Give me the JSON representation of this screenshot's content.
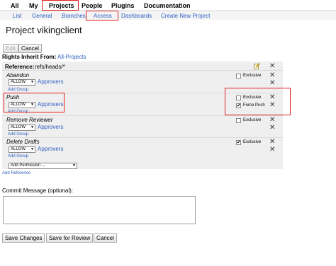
{
  "topnav": {
    "items": [
      {
        "label": "All"
      },
      {
        "label": "My"
      },
      {
        "label": "Projects"
      },
      {
        "label": "People"
      },
      {
        "label": "Plugins"
      },
      {
        "label": "Documentation"
      }
    ]
  },
  "subnav": {
    "items": [
      {
        "label": "List"
      },
      {
        "label": "General"
      },
      {
        "label": "Branches"
      },
      {
        "label": "Access"
      },
      {
        "label": "Dashboards"
      },
      {
        "label": "Create New Project"
      }
    ]
  },
  "page": {
    "title": "Project vikingclient",
    "edit_label": "Edit",
    "cancel_label": "Cancel",
    "rights_inherit_label": "Rights Inherit From:",
    "rights_inherit_link": "All-Projects"
  },
  "reference": {
    "label": "Reference:",
    "value": "refs/heads/*"
  },
  "permissions": [
    {
      "name": "Abandon",
      "rule_action": "ALLOW",
      "group": "Approvers",
      "add_group": "Add Group",
      "options": [
        {
          "label": "Exclusive",
          "checked": false
        }
      ]
    },
    {
      "name": "Push",
      "rule_action": "ALLOW",
      "group": "Approvers",
      "add_group": "Add Group",
      "options": [
        {
          "label": "Exclusive",
          "checked": false
        },
        {
          "label": "Force Push",
          "checked": true
        }
      ]
    },
    {
      "name": "Remove Reviewer",
      "rule_action": "ALLOW",
      "group": "Approvers",
      "add_group": "Add Group",
      "options": [
        {
          "label": "Exclusive",
          "checked": false
        }
      ]
    },
    {
      "name": "Delete Drafts",
      "rule_action": "ALLOW",
      "group": "Approvers",
      "add_group": "Add Group",
      "options": [
        {
          "label": "Exclusive",
          "checked": true
        }
      ]
    }
  ],
  "add_permission_placeholder": "Add Permission ...",
  "add_reference_label": "Add Reference",
  "commit": {
    "label": "Commit Message (optional):",
    "value": ""
  },
  "footer": {
    "save_label": "Save Changes",
    "review_label": "Save for Review",
    "cancel_label": "Cancel"
  },
  "colors": {
    "link": "#2d5ec2",
    "highlight": "#e02020",
    "panel": "#efefef"
  },
  "icons": {
    "edit": "edit-icon",
    "remove": "close-icon"
  }
}
